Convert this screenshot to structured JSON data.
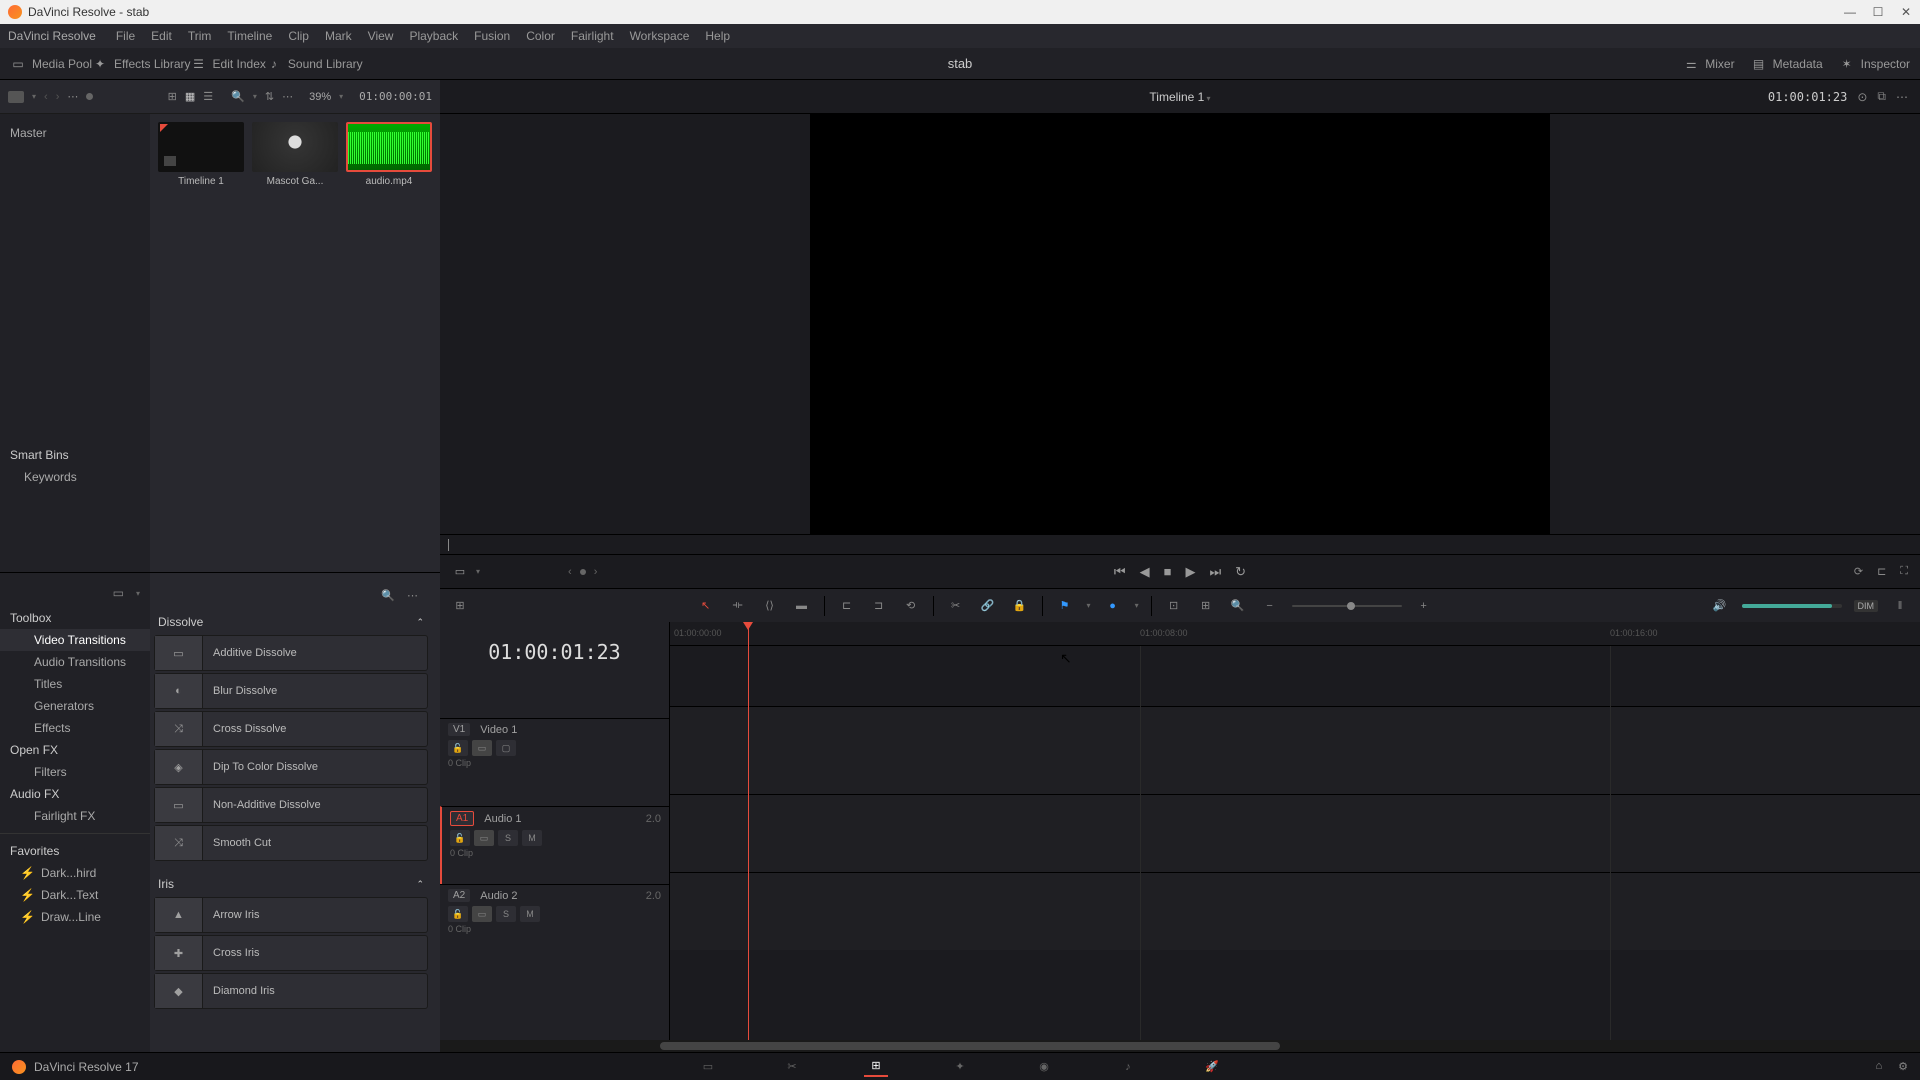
{
  "window": {
    "title": "DaVinci Resolve - stab"
  },
  "menu": [
    "DaVinci Resolve",
    "File",
    "Edit",
    "Trim",
    "Timeline",
    "Clip",
    "Mark",
    "View",
    "Playback",
    "Fusion",
    "Color",
    "Fairlight",
    "Workspace",
    "Help"
  ],
  "top_tabs": {
    "media_pool": "Media Pool",
    "effects_library": "Effects Library",
    "edit_index": "Edit Index",
    "sound_library": "Sound Library",
    "mixer": "Mixer",
    "metadata": "Metadata",
    "inspector": "Inspector"
  },
  "project_name": "stab",
  "media_header": {
    "zoom": "39%",
    "position": "01:00:00:01"
  },
  "bins": {
    "master": "Master",
    "smart_bins": "Smart Bins",
    "keywords": "Keywords"
  },
  "clips": [
    {
      "name": "Timeline 1",
      "type": "timeline"
    },
    {
      "name": "Mascot Ga...",
      "type": "video"
    },
    {
      "name": "audio.mp4",
      "type": "audio",
      "selected": true
    }
  ],
  "fx_sidebar": {
    "toolbox": "Toolbox",
    "video_transitions": "Video Transitions",
    "audio_transitions": "Audio Transitions",
    "titles": "Titles",
    "generators": "Generators",
    "effects": "Effects",
    "open_fx": "Open FX",
    "filters": "Filters",
    "audio_fx": "Audio FX",
    "fairlight_fx": "Fairlight FX",
    "favorites": "Favorites",
    "fav_items": [
      "Dark...hird",
      "Dark...Text",
      "Draw...Line"
    ]
  },
  "fx_list": {
    "dissolve": {
      "header": "Dissolve",
      "items": [
        "Additive Dissolve",
        "Blur Dissolve",
        "Cross Dissolve",
        "Dip To Color Dissolve",
        "Non-Additive Dissolve",
        "Smooth Cut"
      ]
    },
    "iris": {
      "header": "Iris",
      "items": [
        "Arrow Iris",
        "Cross Iris",
        "Diamond Iris"
      ]
    }
  },
  "viewer": {
    "timeline_name": "Timeline 1",
    "timecode_right": "01:00:01:23"
  },
  "timeline": {
    "timecode": "01:00:01:23",
    "ruler_marks": [
      "01:00:00:00",
      "01:00:08:00",
      "01:00:16:00"
    ],
    "tracks": {
      "v1": {
        "index": "V1",
        "name": "Video 1",
        "clips_info": "0 Clip"
      },
      "a1": {
        "index": "A1",
        "name": "Audio 1",
        "format": "2.0",
        "clips_info": "0 Clip"
      },
      "a2": {
        "index": "A2",
        "name": "Audio 2",
        "format": "2.0",
        "clips_info": "0 Clip"
      }
    },
    "track_btns": {
      "solo": "S",
      "mute": "M"
    }
  },
  "dim_label": "DIM",
  "footer": {
    "app_name": "DaVinci Resolve 17"
  }
}
